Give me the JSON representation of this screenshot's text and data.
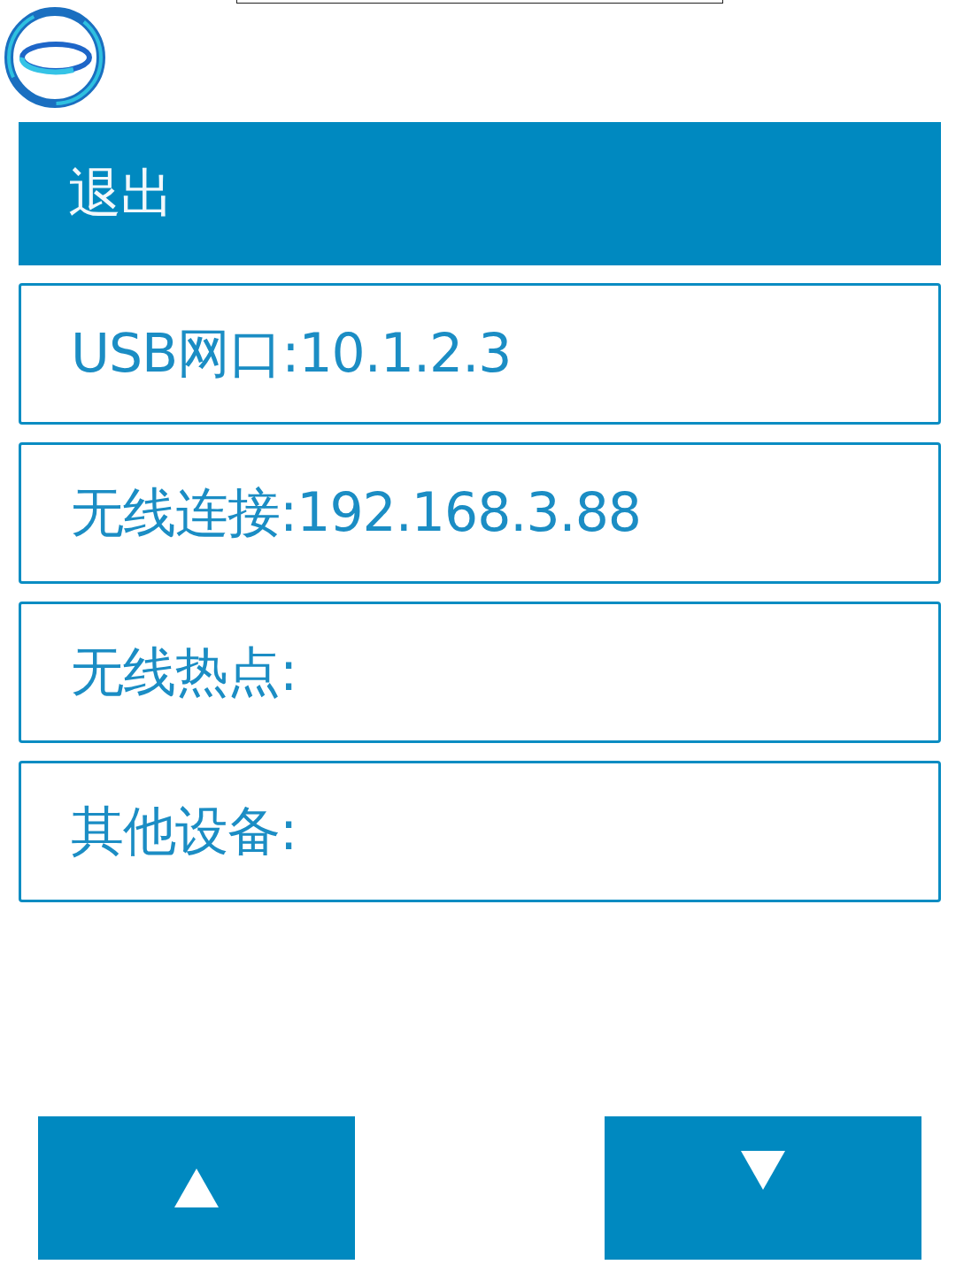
{
  "menu": [
    {
      "kind": "exit",
      "label": "退出"
    },
    {
      "kind": "info",
      "label": "USB网口:10.1.2.3"
    },
    {
      "kind": "info",
      "label": "无线连接:192.168.3.88"
    },
    {
      "kind": "info",
      "label": "无线热点:"
    },
    {
      "kind": "info",
      "label": "其他设备:"
    }
  ],
  "buttons": [
    {
      "kind": "up"
    },
    {
      "kind": "down"
    }
  ]
}
